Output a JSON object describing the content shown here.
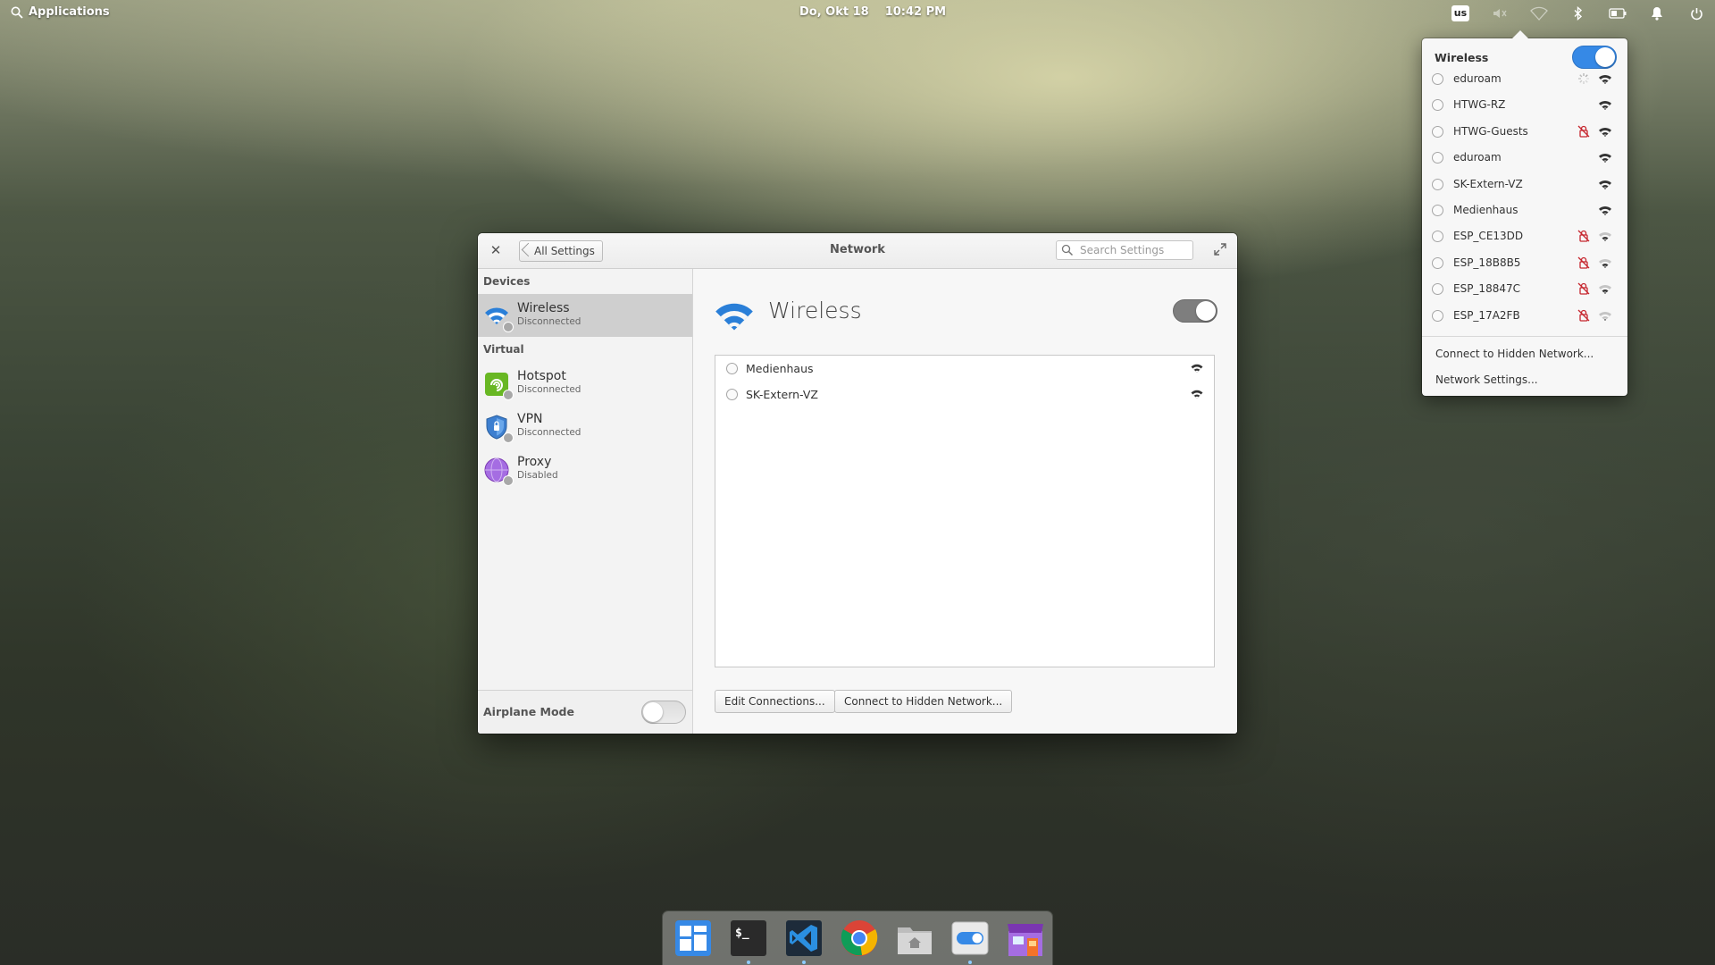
{
  "panel": {
    "applications_label": "Applications",
    "date": "Do, Okt 18",
    "time": "10:42 PM",
    "keyboard_layout": "us"
  },
  "window": {
    "title": "Network",
    "back_label": "All Settings",
    "search_placeholder": "Search Settings"
  },
  "sidebar": {
    "devices_heading": "Devices",
    "virtual_heading": "Virtual",
    "devices": [
      {
        "title": "Wireless",
        "status": "Disconnected"
      }
    ],
    "virtual": [
      {
        "title": "Hotspot",
        "status": "Disconnected"
      },
      {
        "title": "VPN",
        "status": "Disconnected"
      },
      {
        "title": "Proxy",
        "status": "Disabled"
      }
    ],
    "airplane_mode_label": "Airplane Mode",
    "airplane_mode_on": false
  },
  "main": {
    "title": "Wireless",
    "wireless_enabled": true,
    "networks": [
      {
        "name": "Medienhaus"
      },
      {
        "name": "SK-Extern-VZ"
      }
    ],
    "edit_connections_label": "Edit Connections...",
    "connect_hidden_label": "Connect to Hidden Network..."
  },
  "popover": {
    "title": "Wireless",
    "wireless_enabled": true,
    "networks": [
      {
        "name": "eduroam",
        "locked": false,
        "connecting": true,
        "strength": 1.0
      },
      {
        "name": "HTWG-RZ",
        "locked": false,
        "connecting": false,
        "strength": 1.0
      },
      {
        "name": "HTWG-Guests",
        "locked": true,
        "connecting": false,
        "strength": 1.0
      },
      {
        "name": "eduroam",
        "locked": false,
        "connecting": false,
        "strength": 1.0
      },
      {
        "name": "SK-Extern-VZ",
        "locked": false,
        "connecting": false,
        "strength": 1.0
      },
      {
        "name": "Medienhaus",
        "locked": false,
        "connecting": false,
        "strength": 1.0
      },
      {
        "name": "ESP_CE13DD",
        "locked": true,
        "connecting": false,
        "strength": 0.5
      },
      {
        "name": "ESP_18B8B5",
        "locked": true,
        "connecting": false,
        "strength": 0.5
      },
      {
        "name": "ESP_18847C",
        "locked": true,
        "connecting": false,
        "strength": 0.5
      },
      {
        "name": "ESP_17A2FB",
        "locked": true,
        "connecting": false,
        "strength": 0.25
      }
    ],
    "connect_hidden_label": "Connect to Hidden Network...",
    "network_settings_label": "Network Settings..."
  },
  "dock": {
    "items": [
      {
        "icon": "multitasking-view-icon",
        "running": false
      },
      {
        "icon": "terminal-icon",
        "running": true
      },
      {
        "icon": "vscode-icon",
        "running": true
      },
      {
        "icon": "chrome-icon",
        "running": false
      },
      {
        "icon": "files-icon",
        "running": false
      },
      {
        "icon": "system-settings-icon",
        "running": true
      },
      {
        "icon": "appcenter-icon",
        "running": false
      }
    ]
  },
  "colors": {
    "accent": "#3689e6",
    "wifi_blue": "#2a7fd8"
  }
}
